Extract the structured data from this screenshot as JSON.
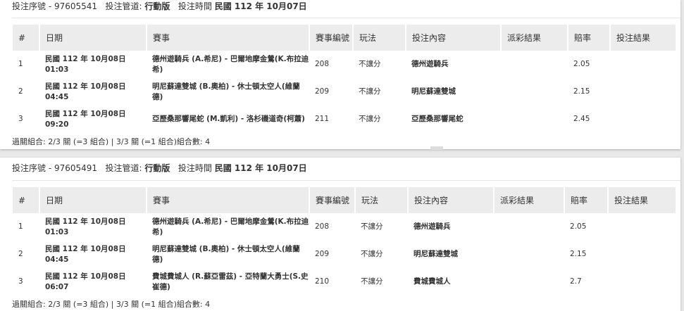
{
  "columns": [
    "#",
    "日期",
    "賽事",
    "賽事編號",
    "玩法",
    "投注內容",
    "派彩結果",
    "賠率",
    "投注結果"
  ],
  "header_labels": {
    "serial": "投注序號",
    "channel": "投注管道:",
    "time": "投注時間"
  },
  "bets": [
    {
      "serial": "97605541",
      "channel": "行動版",
      "bet_time": "民國 112 年 10月07日",
      "rows": [
        {
          "no": "1",
          "date": "民國 112 年 10月08日",
          "time": "01:03",
          "match": "德州遊騎兵 (A.希尼) - 巴爾地摩金鶯(K.布拉迪希)",
          "code": "208",
          "play": "不讓分",
          "pick": "德州遊騎兵",
          "payout": "",
          "odds": "2.05",
          "result": ""
        },
        {
          "no": "2",
          "date": "民國 112 年 10月08日",
          "time": "04:45",
          "match": "明尼蘇達雙城 (B.奧柏) - 休士頓太空人(維蘭德)",
          "code": "209",
          "play": "不讓分",
          "pick": "明尼蘇達雙城",
          "payout": "",
          "odds": "2.15",
          "result": ""
        },
        {
          "no": "3",
          "date": "民國 112 年 10月08日",
          "time": "09:20",
          "match": "亞歷桑那響尾蛇 (M.凱利) - 洛杉磯道奇(柯蕭)",
          "code": "211",
          "play": "不讓分",
          "pick": "亞歷桑那響尾蛇",
          "payout": "",
          "odds": "2.45",
          "result": ""
        }
      ],
      "summary": "過關組合: 2/3 關 (=3 組合) | 3/3 關 (=1 組合)組合數: 4"
    },
    {
      "serial": "97605491",
      "channel": "行動版",
      "bet_time": "民國 112 年 10月07日",
      "rows": [
        {
          "no": "1",
          "date": "民國 112 年 10月08日",
          "time": "01:03",
          "match": "德州遊騎兵 (A.希尼) - 巴爾地摩金鶯(K.布拉迪希)",
          "code": "208",
          "play": "不讓分",
          "pick": "德州遊騎兵",
          "payout": "",
          "odds": "2.05",
          "result": ""
        },
        {
          "no": "2",
          "date": "民國 112 年 10月08日",
          "time": "04:45",
          "match": "明尼蘇達雙城 (B.奧柏) - 休士頓太空人(維蘭德)",
          "code": "209",
          "play": "不讓分",
          "pick": "明尼蘇達雙城",
          "payout": "",
          "odds": "2.15",
          "result": ""
        },
        {
          "no": "3",
          "date": "民國 112 年 10月08日",
          "time": "06:07",
          "match": "費城費城人 (R.蘇亞雷茲) - 亞特蘭大勇士(S.史崔德)",
          "code": "210",
          "play": "不讓分",
          "pick": "費城費城人",
          "payout": "",
          "odds": "2.7",
          "result": ""
        }
      ],
      "summary": "過關組合: 2/3 關 (=3 組合) | 3/3 關 (=1 組合)組合數: 4"
    }
  ]
}
